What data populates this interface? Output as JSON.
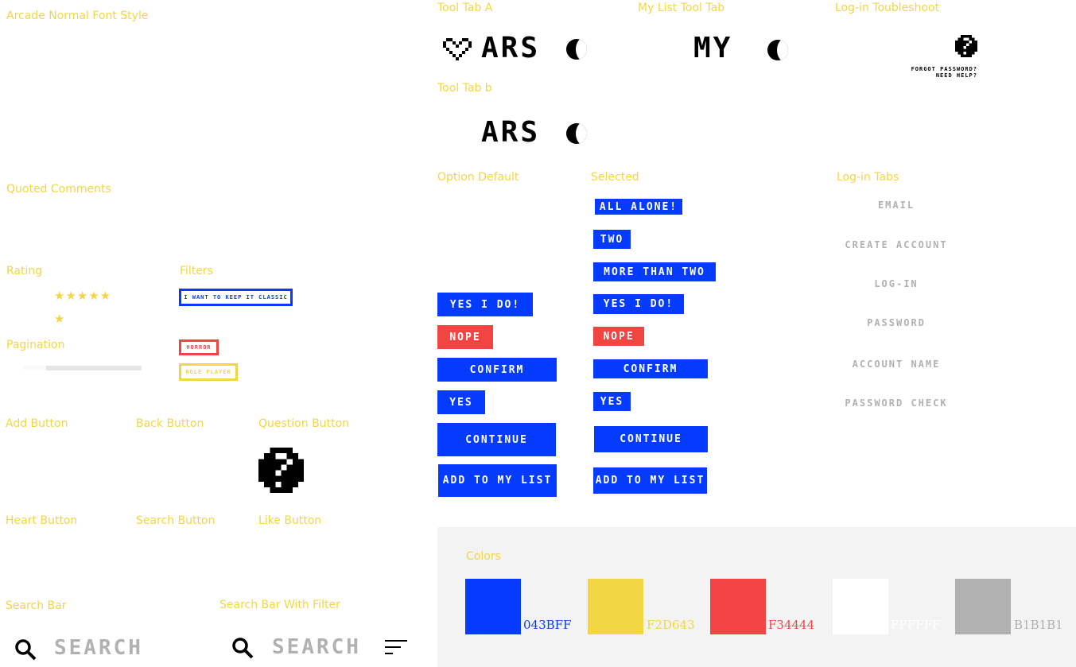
{
  "labels": {
    "arcade_font": "Arcade Normal Font Style",
    "quoted_comments": "Quoted Comments",
    "rating": "Rating",
    "filters": "Filters",
    "pagination": "Pagination",
    "add_button": "Add Button",
    "back_button": "Back Button",
    "question_button": "Question Button",
    "heart_button": "Heart Button",
    "search_button": "Search Button",
    "like_button": "Like Button",
    "search_bar": "Search Bar",
    "search_bar_filter": "Search Bar With Filter",
    "tool_tab_a": "Tool Tab A",
    "my_list_tool_tab": "My List Tool Tab",
    "login_troubleshoot": "Log-in Toubleshoot",
    "tool_tab_b": "Tool Tab b",
    "option_default": "Option Default",
    "selected": "Selected",
    "login_tabs": "Log-in Tabs",
    "colors": "Colors"
  },
  "tool_tabs": {
    "a_text": "ARS",
    "my_list_text": "MY",
    "b_text": "ARS"
  },
  "troubleshoot": {
    "forgot": "FORGOT PASSWORD?",
    "need_help": "NEED  HELP?"
  },
  "filters": {
    "classic": "I WANT TO KEEP IT CLASSIC",
    "horror": "HORROR",
    "role_player": "ROLE PLAYER"
  },
  "options_default": {
    "yes_i_do": "YES I DO!",
    "nope": "NOPE",
    "confirm": "CONFIRM",
    "yes": "YES",
    "continue": "CONTINUE",
    "add_to_my_list": "ADD TO MY LIST"
  },
  "options_selected": {
    "all_alone": "ALL ALONE!",
    "two": "TWO",
    "more_than_two": "MORE THAN TWO",
    "yes_i_do": "YES I DO!",
    "nope": "NOPE",
    "confirm": "CONFIRM",
    "yes": "YES",
    "continue": "CONTINUE",
    "add_to_my_list": "ADD TO MY LIST"
  },
  "login_tabs": {
    "email": "EMAIL",
    "create_account": "CREATE ACCOUNT",
    "login": "LOG-IN",
    "password": "PASSWORD",
    "account_name": "ACCOUNT NAME",
    "password_check": "PASSWORD CHECK"
  },
  "search": {
    "placeholder": "SEARCH",
    "placeholder_filter": "SEARCH"
  },
  "rating": {
    "stars": "★★★★★★"
  },
  "colors": {
    "blue": "043BFF",
    "yellow": "F2D643",
    "red": "F34444",
    "white": "FFFFFF",
    "gray": "B1B1B1"
  }
}
